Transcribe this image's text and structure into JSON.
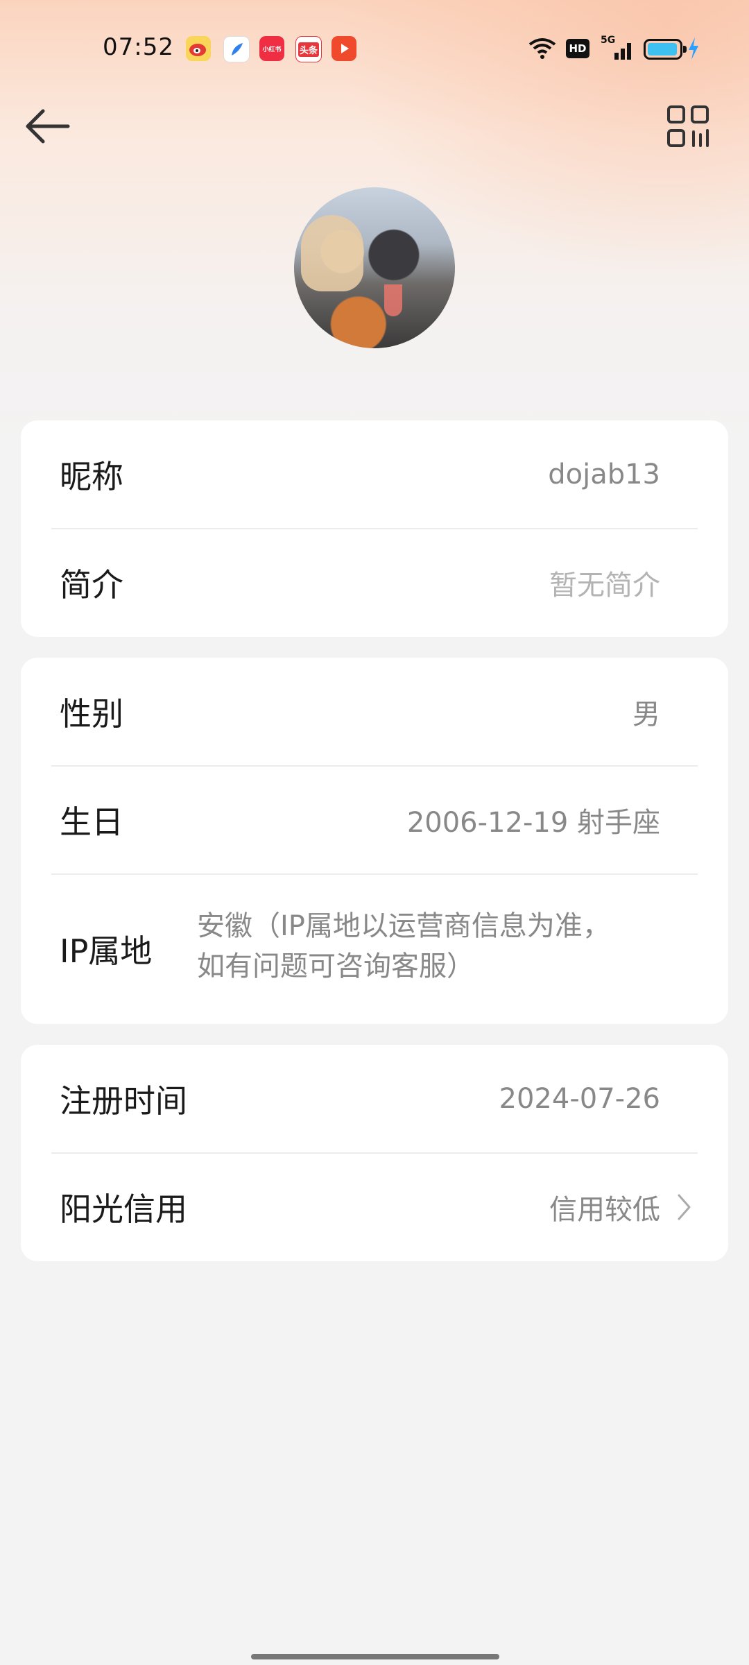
{
  "status_bar": {
    "time": "07:52",
    "network": "5G",
    "hd": "HD",
    "app_icons": [
      {
        "name": "weibo-icon",
        "color": "#f6c342"
      },
      {
        "name": "feather-app-icon",
        "color": "#3a8ef5"
      },
      {
        "name": "xiaohongshu-icon",
        "color": "#ef2d43",
        "text": "小红书"
      },
      {
        "name": "toutiao-icon",
        "color": "#e8373c",
        "text": "头条"
      },
      {
        "name": "video-play-icon",
        "color": "#f04a2c"
      }
    ],
    "battery_color": "#3ec1f0",
    "charging_color": "#2aa0ff"
  },
  "nav": {
    "back_icon": "arrow-left-icon",
    "qr_icon": "qr-code-icon"
  },
  "profile": {
    "fields": [
      {
        "label": "昵称",
        "value": "dojab13"
      },
      {
        "label": "简介",
        "value": "暂无简介"
      },
      {
        "label": "性别",
        "value": "男"
      },
      {
        "label": "生日",
        "value": "2006-12-19 射手座"
      },
      {
        "label": "IP属地",
        "value_line1": "安徽（IP属地以运营商信息为准，",
        "value_line2": "如有问题可咨询客服）"
      },
      {
        "label": "注册时间",
        "value": "2024-07-26"
      },
      {
        "label": "阳光信用",
        "value": "信用较低"
      }
    ]
  }
}
